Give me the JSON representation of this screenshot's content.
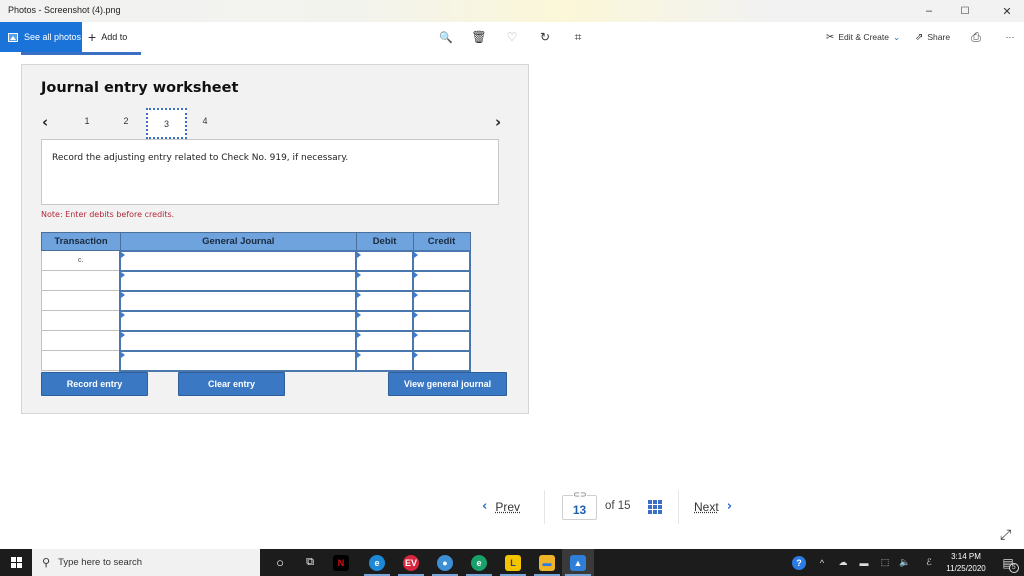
{
  "window": {
    "title": "Photos - Screenshot (4).png",
    "minimize": "–",
    "maximize": "☐",
    "close": "✕"
  },
  "toolbar": {
    "see_all_photos": "See all photos",
    "add_to": "Add to",
    "add_to_icon": "+",
    "zoom_icon": "🔍",
    "delete_icon": "🗑",
    "favorite_icon": "♡",
    "rotate_icon": "↻",
    "crop_icon": "⌗",
    "edit_create": "Edit & Create",
    "edit_create_chevron": "⌄",
    "share": "Share",
    "print_icon": "⎙",
    "more_icon": "···"
  },
  "worksheet": {
    "title": "Journal entry worksheet",
    "pager": {
      "prev_icon": "‹",
      "next_icon": "›",
      "pages": [
        "1",
        "2",
        "3",
        "4"
      ],
      "active_page": "3"
    },
    "instruction": "Record the adjusting entry related to Check No. 919, if necessary.",
    "note": "Note: Enter debits before credits.",
    "table": {
      "headers": [
        "Transaction",
        "General Journal",
        "Debit",
        "Credit"
      ],
      "rows": [
        {
          "transaction": "c.",
          "general_journal": "",
          "debit": "",
          "credit": ""
        },
        {
          "transaction": "",
          "general_journal": "",
          "debit": "",
          "credit": ""
        },
        {
          "transaction": "",
          "general_journal": "",
          "debit": "",
          "credit": ""
        },
        {
          "transaction": "",
          "general_journal": "",
          "debit": "",
          "credit": ""
        },
        {
          "transaction": "",
          "general_journal": "",
          "debit": "",
          "credit": ""
        },
        {
          "transaction": "",
          "general_journal": "",
          "debit": "",
          "credit": ""
        }
      ]
    },
    "buttons": {
      "record_entry": "Record entry",
      "clear_entry": "Clear entry",
      "view_general_journal": "View general journal"
    }
  },
  "navigation": {
    "prev_label": "Prev",
    "prev_icon": "‹",
    "link_icon": "⊂⊃",
    "current_page": "13",
    "of_total": "of 15",
    "next_label": "Next",
    "next_icon": "›"
  },
  "expand_icon": "⤢",
  "taskbar": {
    "search_placeholder": "Type here to search",
    "search_icon": "⚲",
    "cortana_icon": "○",
    "taskview_icon": "⧉",
    "apps": [
      {
        "name": "netflix",
        "glyph": "N",
        "color": "#000000",
        "fg": "#e50914"
      },
      {
        "name": "edge",
        "glyph": "e",
        "color": "#1e88d8",
        "fg": "#ffffff"
      },
      {
        "name": "expressvpn",
        "glyph": "EV",
        "color": "#d7263d",
        "fg": "#ffffff"
      },
      {
        "name": "chrome-profile",
        "glyph": "●",
        "color": "#3d8fd6",
        "fg": "#ffffff"
      },
      {
        "name": "edge-beta",
        "glyph": "e",
        "color": "#1aa06a",
        "fg": "#ffffff"
      },
      {
        "name": "lingoes",
        "glyph": "L",
        "color": "#f5c400",
        "fg": "#1a3d8f"
      },
      {
        "name": "file-explorer",
        "glyph": "▬",
        "color": "#f0b429",
        "fg": "#2a7be4"
      },
      {
        "name": "photos",
        "glyph": "▲",
        "color": "#2f7fd8",
        "fg": "#ffffff"
      }
    ],
    "tray": {
      "help_icon": "?",
      "chevron_icon": "^",
      "time": "3:14 PM",
      "date": "11/25/2020",
      "notifications_count": "5"
    }
  }
}
